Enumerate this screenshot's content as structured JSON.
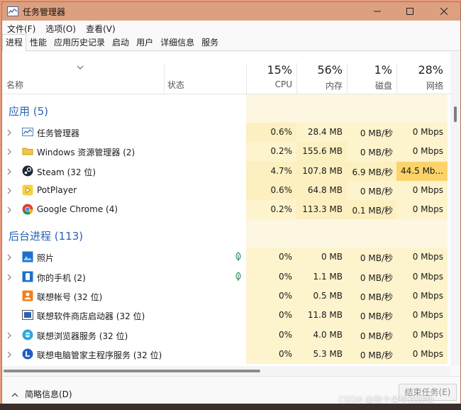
{
  "window": {
    "title": "任务管理器"
  },
  "menu": [
    "文件(F)",
    "选项(O)",
    "查看(V)"
  ],
  "tabs": [
    "进程",
    "性能",
    "应用历史记录",
    "启动",
    "用户",
    "详细信息",
    "服务"
  ],
  "columns": {
    "name": "名称",
    "status": "状态",
    "cpu": {
      "pct": "15%",
      "label": "CPU"
    },
    "memory": {
      "pct": "56%",
      "label": "内存"
    },
    "disk": {
      "pct": "1%",
      "label": "磁盘"
    },
    "network": {
      "pct": "28%",
      "label": "网络"
    }
  },
  "groups": {
    "apps": "应用 (5)",
    "background": "后台进程 (113)"
  },
  "apps": [
    {
      "name": "任务管理器",
      "icon": "task-manager-icon",
      "cpu": "0.6%",
      "mem": "28.4 MB",
      "disk": "0 MB/秒",
      "net": "0 Mbps"
    },
    {
      "name": "Windows 资源管理器 (2)",
      "icon": "folder-icon",
      "cpu": "0.2%",
      "mem": "155.6 MB",
      "disk": "0 MB/秒",
      "net": "0 Mbps"
    },
    {
      "name": "Steam (32 位)",
      "icon": "steam-icon",
      "cpu": "4.7%",
      "mem": "107.8 MB",
      "disk": "6.9 MB/秒",
      "net": "44.5 Mb..."
    },
    {
      "name": "PotPlayer",
      "icon": "potplayer-icon",
      "cpu": "0.6%",
      "mem": "64.8 MB",
      "disk": "0 MB/秒",
      "net": "0 Mbps"
    },
    {
      "name": "Google Chrome (4)",
      "icon": "chrome-icon",
      "cpu": "0.2%",
      "mem": "113.3 MB",
      "disk": "0.1 MB/秒",
      "net": "0 Mbps"
    }
  ],
  "background": [
    {
      "name": "照片",
      "icon": "photos-icon",
      "cpu": "0%",
      "mem": "0 MB",
      "disk": "0 MB/秒",
      "net": "0 Mbps"
    },
    {
      "name": "你的手机 (2)",
      "icon": "your-phone-icon",
      "cpu": "0%",
      "mem": "1.1 MB",
      "disk": "0 MB/秒",
      "net": "0 Mbps"
    },
    {
      "name": "联想帐号 (32 位)",
      "icon": "lenovo-id-icon",
      "cpu": "0%",
      "mem": "0.5 MB",
      "disk": "0 MB/秒",
      "net": "0 Mbps"
    },
    {
      "name": "联想软件商店启动器 (32 位)",
      "icon": "lenovo-store-icon",
      "cpu": "0%",
      "mem": "11.8 MB",
      "disk": "0 MB/秒",
      "net": "0 Mbps"
    },
    {
      "name": "联想浏览器服务 (32 位)",
      "icon": "lenovo-browser-icon",
      "cpu": "0%",
      "mem": "4.0 MB",
      "disk": "0 MB/秒",
      "net": "0 Mbps"
    },
    {
      "name": "联想电脑管家主程序服务 (32 位)",
      "icon": "lenovo-pc-manager-icon",
      "cpu": "0%",
      "mem": "5.3 MB",
      "disk": "0 MB/秒",
      "net": "0 Mbps"
    }
  ],
  "footer": {
    "brief": "简略信息(D)",
    "end_task": "结束任务(E)"
  },
  "watermark": "CSDN @取个名字真难呐"
}
